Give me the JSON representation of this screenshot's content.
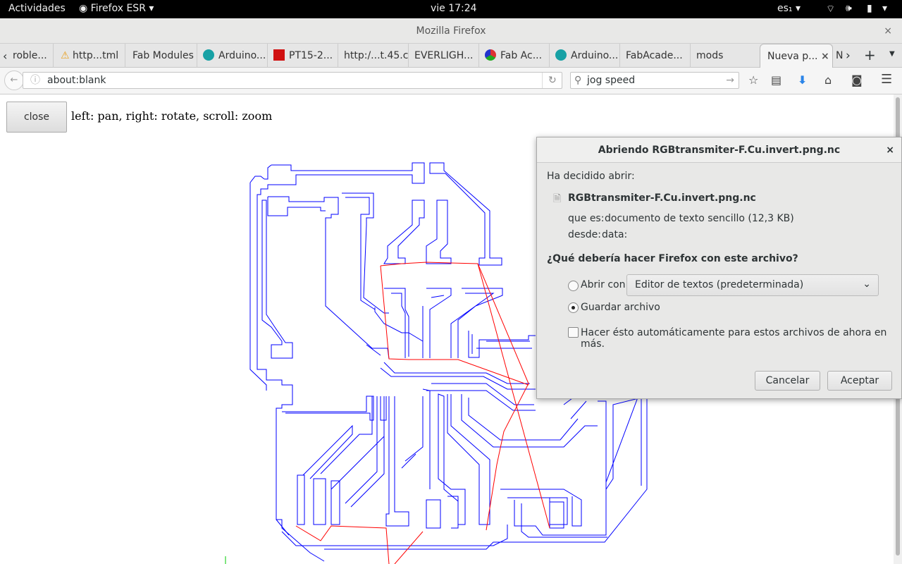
{
  "topbar": {
    "activities": "Actividades",
    "app": "Firefox ESR ▾",
    "clock": "vie 17:24",
    "keyboard": "es₁ ▾",
    "status_icons": [
      "wifi-icon",
      "volume-icon",
      "battery-icon",
      "power-menu-icon"
    ]
  },
  "window": {
    "title": "Mozilla Firefox",
    "close": "×"
  },
  "tabs": [
    {
      "label": "roble..."
    },
    {
      "label": "http...tml",
      "icon": "warning-icon"
    },
    {
      "label": "Fab Modules"
    },
    {
      "label": "Arduino...",
      "icon": "arduino-icon"
    },
    {
      "label": "PT15-2...",
      "icon": "pt-icon"
    },
    {
      "label": "http:/...t.45.c"
    },
    {
      "label": "EVERLIGH..."
    },
    {
      "label": "Fab Ac...",
      "icon": "fab-academy-icon"
    },
    {
      "label": "Arduino...",
      "icon": "arduino-icon"
    },
    {
      "label": "FabAcade..."
    },
    {
      "label": "mods"
    },
    {
      "label": "Nueva p...",
      "active": true
    },
    {
      "label": "N"
    }
  ],
  "tab_close": "×",
  "navbar": {
    "url": "about:blank",
    "search": "jog speed"
  },
  "page": {
    "close_button": "close",
    "hint": "left: pan, right: rotate, scroll: zoom"
  },
  "colors": {
    "toolpath": "#0000ff",
    "rapid_moves": "#ff0000",
    "download_arrow": "#2a84e8"
  },
  "dialog": {
    "title": "Abriendo RGBtransmiter-F.Cu.invert.png.nc",
    "close": "×",
    "decided": "Ha decidido abrir:",
    "filename": "RGBtransmiter-F.Cu.invert.png.nc",
    "type_label": "que es:",
    "type_value": "documento de texto sencillo (12,3 KB)",
    "from_label": "desde:",
    "from_value": "data:",
    "question": "¿Qué debería hacer Firefox con este archivo?",
    "open_with": "Abrir con",
    "open_with_app": "Editor de textos (predeterminada)",
    "save_file": "Guardar archivo",
    "selected": "save_file",
    "auto": "Hacer ésto automáticamente para estos archivos de ahora en más.",
    "auto_checked": false,
    "cancel": "Cancelar",
    "accept": "Aceptar"
  }
}
